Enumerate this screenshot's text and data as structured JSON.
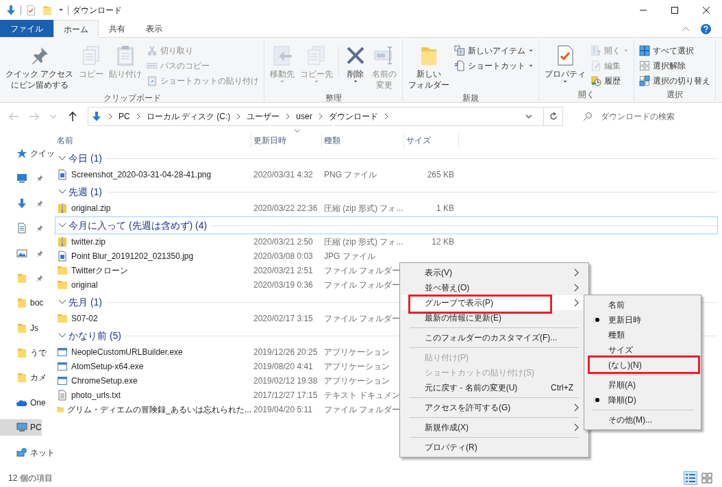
{
  "title_bar": {
    "title": "ダウンロード"
  },
  "ribbon": {
    "tabs": [
      {
        "label": "ファイル",
        "kind": "file",
        "selected": false
      },
      {
        "label": "ホーム",
        "kind": "tab",
        "selected": true
      },
      {
        "label": "共有",
        "kind": "tab",
        "selected": false
      },
      {
        "label": "表示",
        "kind": "tab",
        "selected": false
      }
    ],
    "groups": [
      {
        "label": "クリップボード",
        "items": [
          {
            "kind": "large",
            "lines": [
              "クイック アクセス",
              "にピン留めする"
            ],
            "disabled": false,
            "dropdown": false
          },
          {
            "kind": "large",
            "label": "コピー",
            "disabled": true,
            "dropdown": false
          },
          {
            "kind": "large",
            "label": "貼り付け",
            "disabled": true,
            "dropdown": false
          },
          {
            "kind": "small",
            "label": "切り取り",
            "disabled": true,
            "dropdown": false
          },
          {
            "kind": "small",
            "label": "パスのコピー",
            "disabled": true,
            "dropdown": false
          },
          {
            "kind": "small",
            "label": "ショートカットの貼り付け",
            "disabled": true,
            "dropdown": false
          }
        ]
      },
      {
        "label": "整理",
        "items": [
          {
            "kind": "large",
            "label": "移動先",
            "disabled": true,
            "dropdown": true
          },
          {
            "kind": "large",
            "label": "コピー先",
            "disabled": true,
            "dropdown": true
          },
          {
            "kind": "separator"
          },
          {
            "kind": "large",
            "label": "削除",
            "disabled": false,
            "dropdown": true
          },
          {
            "kind": "large",
            "lines": [
              "名前の",
              "変更"
            ],
            "disabled": true,
            "dropdown": false
          }
        ]
      },
      {
        "label": "新規",
        "items": [
          {
            "kind": "large",
            "lines": [
              "新しい",
              "フォルダー"
            ],
            "disabled": false,
            "dropdown": false
          },
          {
            "kind": "small",
            "label": "新しいアイテム",
            "disabled": false,
            "dropdown": true
          },
          {
            "kind": "small",
            "label": "ショートカット",
            "disabled": false,
            "dropdown": true
          }
        ]
      },
      {
        "label": "開く",
        "items": [
          {
            "kind": "large",
            "label": "プロパティ",
            "disabled": false,
            "dropdown": true
          },
          {
            "kind": "small",
            "label": "開く",
            "disabled": true,
            "dropdown": true
          },
          {
            "kind": "small",
            "label": "編集",
            "disabled": true,
            "dropdown": false
          },
          {
            "kind": "small",
            "label": "履歴",
            "disabled": false,
            "dropdown": false
          }
        ]
      },
      {
        "label": "選択",
        "items": [
          {
            "kind": "small",
            "label": "すべて選択",
            "disabled": false,
            "dropdown": false
          },
          {
            "kind": "small",
            "label": "選択解除",
            "disabled": false,
            "dropdown": false
          },
          {
            "kind": "small",
            "label": "選択の切り替え",
            "disabled": false,
            "dropdown": false
          }
        ]
      }
    ]
  },
  "address_bar": {
    "nav_buttons": [
      {
        "kind": "back",
        "disabled": true
      },
      {
        "kind": "forward",
        "disabled": true
      },
      {
        "kind": "recent",
        "disabled": true
      },
      {
        "kind": "up",
        "disabled": false
      }
    ],
    "path": [
      "PC",
      "ローカル ディスク (C:)",
      "ユーザー",
      "user",
      "ダウンロード"
    ],
    "search": {
      "placeholder": "ダウンロードの検索"
    }
  },
  "nav_pane": {
    "items": [
      {
        "label": "クイッ",
        "pinned": false,
        "selected": false
      },
      {
        "pinned": true,
        "selected": false
      },
      {
        "pinned": true,
        "selected": false
      },
      {
        "pinned": true,
        "selected": false
      },
      {
        "pinned": true,
        "selected": false
      },
      {
        "pinned": true,
        "selected": false
      },
      {
        "label": "boc",
        "pinned": false,
        "selected": false
      },
      {
        "label": "Js",
        "pinned": false,
        "selected": false
      },
      {
        "label": "うで",
        "pinned": false,
        "selected": false
      },
      {
        "label": "カメ",
        "pinned": false,
        "selected": false
      },
      {
        "label": "One",
        "pinned": false,
        "selected": false
      },
      {
        "label": "PC",
        "pinned": false,
        "selected": true
      },
      {
        "label": "ネット",
        "pinned": false,
        "selected": false
      }
    ]
  },
  "file_list": {
    "columns": [
      {
        "label": "名前",
        "sorted": false
      },
      {
        "label": "更新日時",
        "sorted": true
      },
      {
        "label": "種類",
        "sorted": false
      },
      {
        "label": "サイズ",
        "sorted": false
      }
    ],
    "groups": [
      {
        "label": "今日 (1)",
        "selected": false,
        "files": [
          {
            "kind": "image",
            "name": "Screenshot_2020-03-31-04-28-41.png",
            "date": "2020/03/31 4:32",
            "type": "PNG ファイル",
            "size": "265 KB"
          }
        ]
      },
      {
        "label": "先週 (1)",
        "selected": false,
        "files": [
          {
            "kind": "zip",
            "name": "original.zip",
            "date": "2020/03/22 22:36",
            "type": "圧縮 (zip 形式) フォ...",
            "size": "1 KB"
          }
        ]
      },
      {
        "label": "今月に入って (先週は含めず) (4)",
        "selected": true,
        "files": [
          {
            "kind": "zip",
            "name": "twitter.zip",
            "date": "2020/03/21 2:50",
            "type": "圧縮 (zip 形式) フォ...",
            "size": "12 KB"
          },
          {
            "kind": "image",
            "name": "Point Blur_20191202_021350.jpg",
            "date": "2020/03/08 0:03",
            "type": "JPG ファイル"
          },
          {
            "kind": "folder",
            "name": "Twitterクローン",
            "date": "2020/03/21 2:51",
            "type": "ファイル フォルダー"
          },
          {
            "kind": "folder",
            "name": "original",
            "date": "2020/03/19 0:36",
            "type": "ファイル フォルダー"
          }
        ]
      },
      {
        "label": "先月 (1)",
        "selected": false,
        "files": [
          {
            "kind": "folder",
            "name": "S07-02",
            "date": "2020/02/17 3:15",
            "type": "ファイル フォルダー"
          }
        ]
      },
      {
        "label": "かなり前 (5)",
        "selected": false,
        "files": [
          {
            "kind": "app",
            "name": "NeopleCustomURLBuilder.exe",
            "date": "2019/12/26 20:25",
            "type": "アプリケーション"
          },
          {
            "kind": "app",
            "name": "AtomSetup-x64.exe",
            "date": "2019/08/20 4:41",
            "type": "アプリケーション"
          },
          {
            "kind": "app",
            "name": "ChromeSetup.exe",
            "date": "2019/02/12 19:38",
            "type": "アプリケーション"
          },
          {
            "kind": "text",
            "name": "photo_urls.txt",
            "date": "2017/12/27 17:15",
            "type": "テキスト ドキュメン"
          },
          {
            "kind": "folder",
            "name": "グリム・ディエムの冒険録_あるいは忘れられた...",
            "date": "2019/04/20 5:11",
            "type": "ファイル フォルダー"
          }
        ]
      }
    ]
  },
  "status_bar": {
    "text": "12 個の項目",
    "views": [
      {
        "kind": "details",
        "selected": true
      },
      {
        "kind": "tiles",
        "selected": false
      }
    ]
  },
  "context_menu": {
    "items": [
      {
        "kind": "item",
        "label": "表示(V)",
        "submenu": true,
        "disabled": false,
        "selected": false,
        "annotated": false
      },
      {
        "kind": "item",
        "label": "並べ替え(O)",
        "submenu": true,
        "disabled": false,
        "selected": false,
        "annotated": false
      },
      {
        "kind": "item",
        "label": "グループで表示(P)",
        "submenu": true,
        "disabled": false,
        "selected": true,
        "annotated": true
      },
      {
        "kind": "item",
        "label": "最新の情報に更新(E)",
        "submenu": false,
        "disabled": false,
        "selected": false,
        "annotated": false
      },
      {
        "kind": "separator"
      },
      {
        "kind": "item",
        "label": "このフォルダーのカスタマイズ(F)...",
        "submenu": false,
        "disabled": false,
        "selected": false,
        "annotated": false
      },
      {
        "kind": "separator"
      },
      {
        "kind": "item",
        "label": "貼り付け(P)",
        "submenu": false,
        "disabled": true,
        "selected": false,
        "annotated": false
      },
      {
        "kind": "item",
        "label": "ショートカットの貼り付け(S)",
        "submenu": false,
        "disabled": true,
        "selected": false,
        "annotated": false
      },
      {
        "kind": "item",
        "label": "元に戻す - 名前の変更(U)",
        "shortcut": "Ctrl+Z",
        "submenu": false,
        "disabled": false,
        "selected": false,
        "annotated": false
      },
      {
        "kind": "separator"
      },
      {
        "kind": "item",
        "label": "アクセスを許可する(G)",
        "submenu": true,
        "disabled": false,
        "selected": false,
        "annotated": false
      },
      {
        "kind": "separator"
      },
      {
        "kind": "item",
        "label": "新規作成(X)",
        "submenu": true,
        "disabled": false,
        "selected": false,
        "annotated": false
      },
      {
        "kind": "separator"
      },
      {
        "kind": "item",
        "label": "プロパティ(R)",
        "submenu": false,
        "disabled": false,
        "selected": false,
        "annotated": false
      }
    ]
  },
  "submenu": {
    "items": [
      {
        "kind": "item",
        "label": "名前",
        "checked": false,
        "annotated": false
      },
      {
        "kind": "item",
        "label": "更新日時",
        "checked": true,
        "annotated": false
      },
      {
        "kind": "item",
        "label": "種類",
        "checked": false,
        "annotated": false
      },
      {
        "kind": "item",
        "label": "サイズ",
        "checked": false,
        "annotated": false
      },
      {
        "kind": "item",
        "label": "(なし)(N)",
        "checked": false,
        "annotated": true
      },
      {
        "kind": "separator"
      },
      {
        "kind": "item",
        "label": "昇順(A)",
        "checked": false,
        "annotated": false
      },
      {
        "kind": "item",
        "label": "降順(D)",
        "checked": true,
        "annotated": false
      },
      {
        "kind": "separator"
      },
      {
        "kind": "item",
        "label": "その他(M)...",
        "checked": false,
        "annotated": false
      }
    ]
  }
}
